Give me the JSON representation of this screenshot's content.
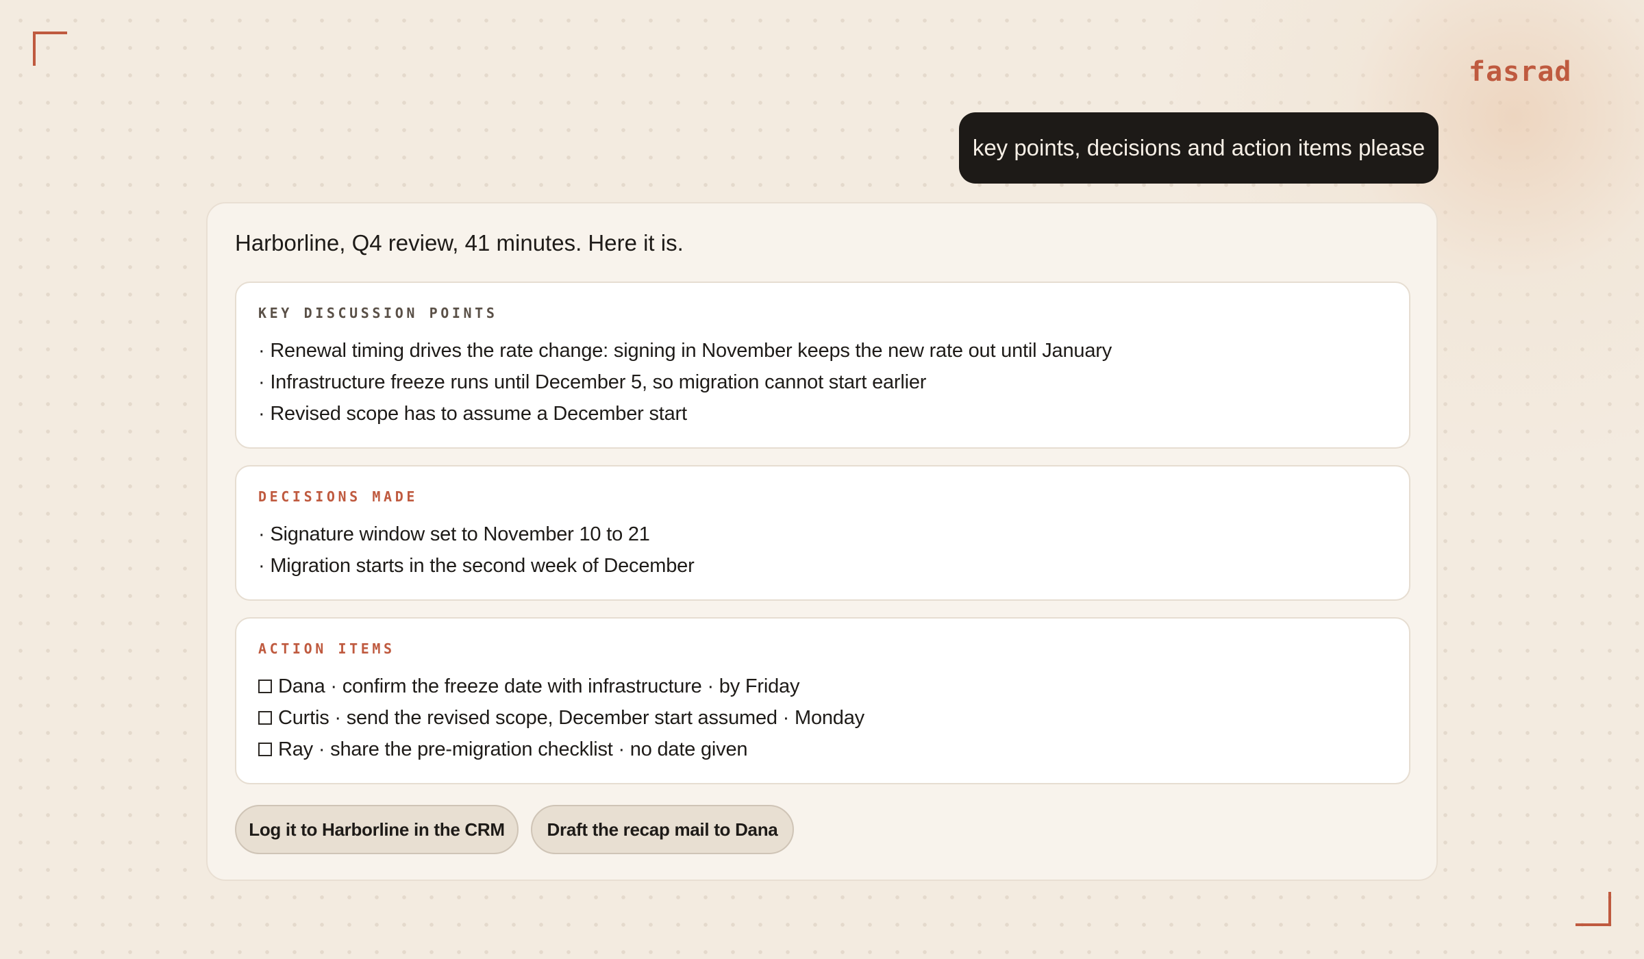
{
  "app": {
    "brand": "fasrad"
  },
  "user_message": "key points, decisions and action items please",
  "assistant": {
    "intro": "Harborline, Q4 review, 41 minutes. Here it is.",
    "key_points": {
      "heading": "KEY DISCUSSION POINTS",
      "items": [
        "· Renewal timing drives the rate change: signing in November keeps the new rate out until January",
        "· Infrastructure freeze runs until December 5, so migration cannot start earlier",
        "· Revised scope has to assume a December start"
      ]
    },
    "decisions": {
      "heading": "DECISIONS MADE",
      "items": [
        "· Signature window set to November 10 to 21",
        "· Migration starts in the second week of December"
      ]
    },
    "action_items": {
      "heading": "ACTION ITEMS",
      "items": [
        {
          "text": "Dana · confirm the freeze date with infrastructure · by Friday",
          "checked": false
        },
        {
          "text": "Curtis · send the revised scope, December start assumed · Monday",
          "checked": false
        },
        {
          "text": "Ray · share the pre-migration checklist · no date given",
          "checked": false
        }
      ]
    },
    "buttons": {
      "log_crm": "Log it to Harborline in the CRM",
      "draft_mail": "Draft the recap mail to Dana"
    }
  },
  "colors": {
    "accent": "#bf5a3f",
    "user_bubble": "#1d1a17",
    "background": "#f3ebe0"
  },
  "icons": {
    "checkbox": "checkbox-unchecked-icon"
  }
}
